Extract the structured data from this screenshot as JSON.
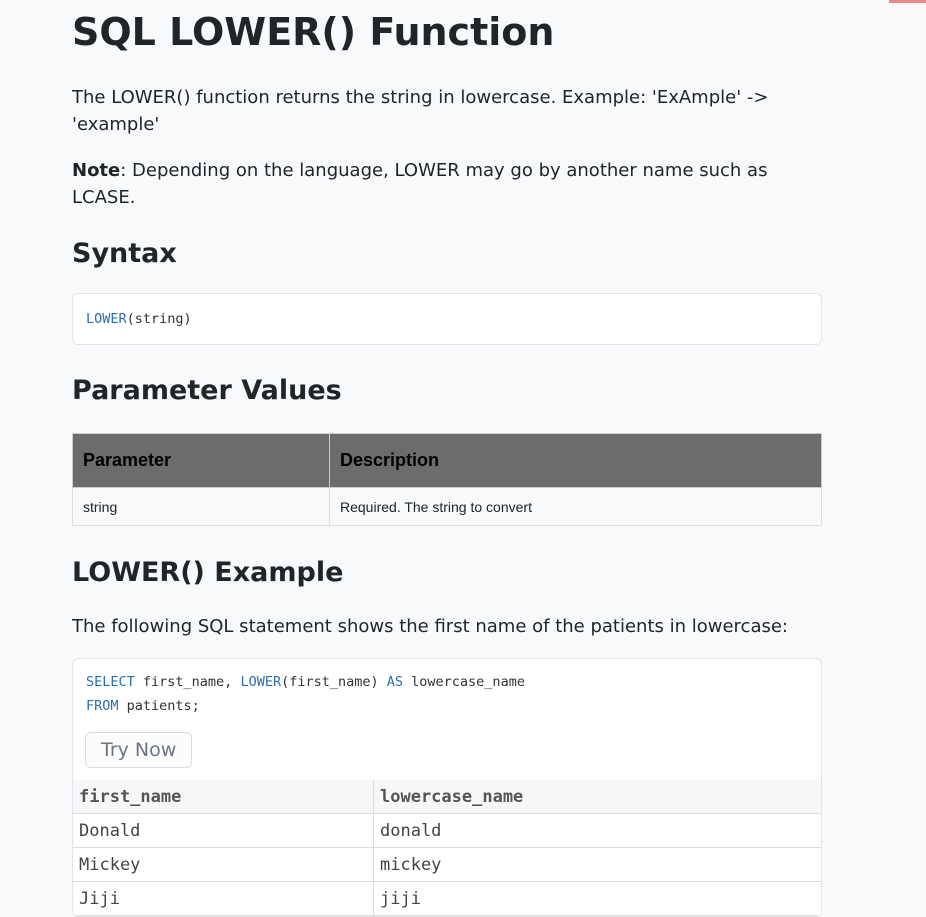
{
  "title": "SQL LOWER() Function",
  "intro": "The LOWER() function returns the string in lowercase. Example: 'ExAmple' -> 'example'",
  "note_label": "Note",
  "note_text": ": Depending on the language, LOWER may go by another name such as LCASE.",
  "syntax_heading": "Syntax",
  "syntax": {
    "fn": "LOWER",
    "args": "(string)"
  },
  "params_heading": "Parameter Values",
  "params": {
    "headers": [
      "Parameter",
      "Description"
    ],
    "rows": [
      [
        "string",
        "Required. The string to convert"
      ]
    ]
  },
  "example_heading": "LOWER() Example",
  "example_text": "The following SQL statement shows the first name of the patients in lowercase:",
  "example_code": {
    "k1": "SELECT",
    "t1": " first_name, ",
    "k2": "LOWER",
    "t2": "(first_name) ",
    "k3": "AS",
    "t3": " lowercase_name",
    "k4": "FROM",
    "t4": " patients;"
  },
  "try_now": "Try Now",
  "result": {
    "headers": [
      "first_name",
      "lowercase_name"
    ],
    "rows": [
      [
        "Donald",
        "donald"
      ],
      [
        "Mickey",
        "mickey"
      ],
      [
        "Jiji",
        "jiji"
      ]
    ]
  }
}
